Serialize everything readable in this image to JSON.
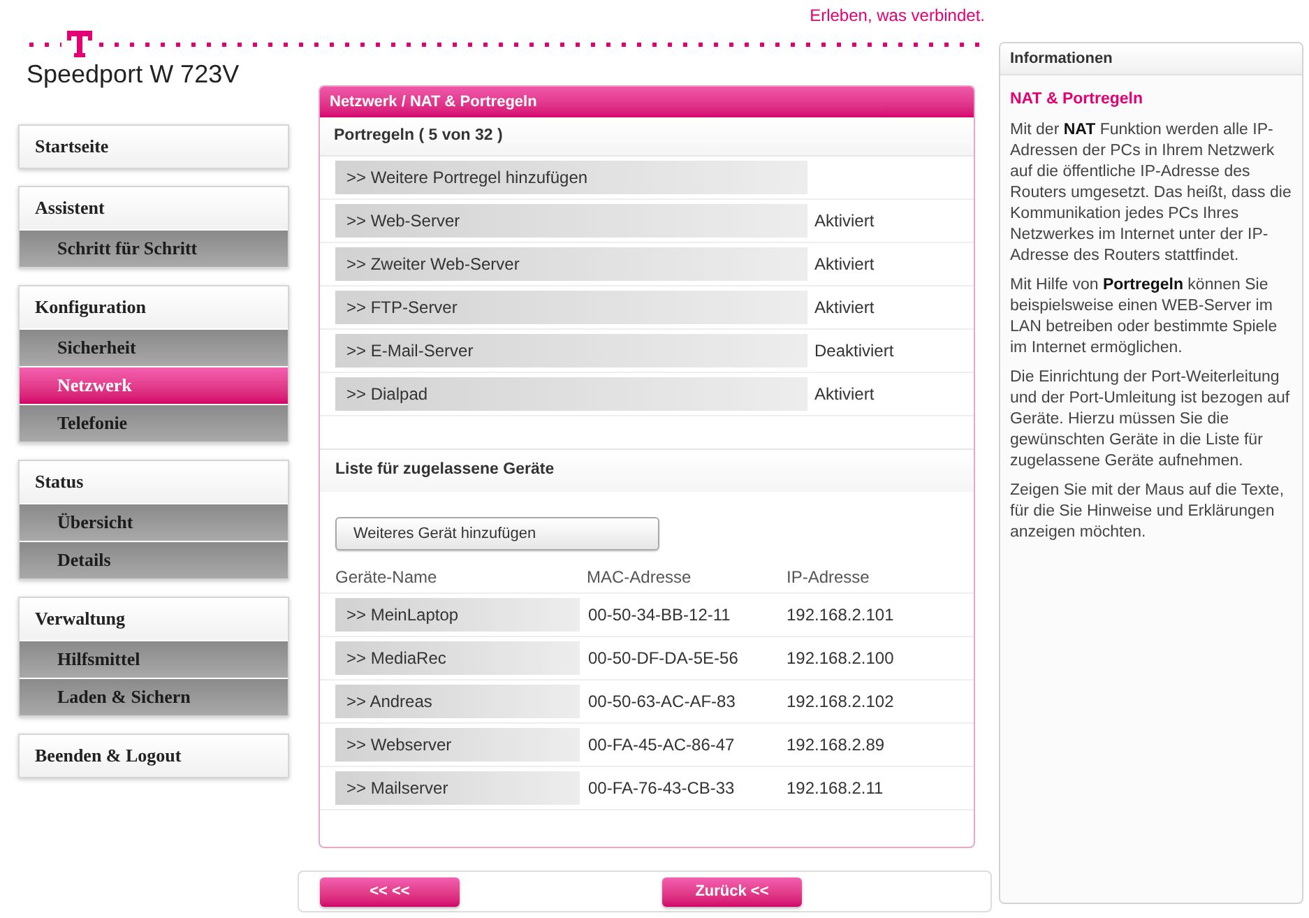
{
  "header": {
    "tagline": "Erleben, was verbindet."
  },
  "sidebar": {
    "title": "Speedport W 723V",
    "groups": [
      {
        "label": "Startseite",
        "selected": false
      },
      {
        "label": "Assistent",
        "selected": false,
        "items": [
          {
            "label": "Schritt für Schritt",
            "selected": false
          }
        ]
      },
      {
        "label": "Konfiguration",
        "selected": false,
        "items": [
          {
            "label": "Sicherheit",
            "selected": false
          },
          {
            "label": "Netzwerk",
            "selected": true
          },
          {
            "label": "Telefonie",
            "selected": false
          }
        ]
      },
      {
        "label": "Status",
        "selected": false,
        "items": [
          {
            "label": "Übersicht",
            "selected": false
          },
          {
            "label": "Details",
            "selected": false
          }
        ]
      },
      {
        "label": "Verwaltung",
        "selected": false,
        "items": [
          {
            "label": "Hilfsmittel",
            "selected": false
          },
          {
            "label": "Laden & Sichern",
            "selected": false
          }
        ]
      },
      {
        "label": "Beenden & Logout",
        "selected": false
      }
    ]
  },
  "panel": {
    "title": "Netzwerk / NAT & Portregeln",
    "port_rules": {
      "heading": "Portregeln ( 5 von 32 )",
      "add_link": ">> Weitere Portregel hinzufügen",
      "rules": [
        {
          "name": ">> Web-Server",
          "status": "Aktiviert"
        },
        {
          "name": ">> Zweiter Web-Server",
          "status": "Aktiviert"
        },
        {
          "name": ">> FTP-Server",
          "status": "Aktiviert"
        },
        {
          "name": ">> E-Mail-Server",
          "status": "Deaktiviert"
        },
        {
          "name": ">> Dialpad",
          "status": "Aktiviert"
        }
      ]
    },
    "devices": {
      "heading": "Liste für zugelassene Geräte",
      "add_button": "Weiteres Gerät hinzufügen",
      "columns": [
        "Geräte-Name",
        "MAC-Adresse",
        "IP-Adresse"
      ],
      "rows": [
        {
          "name": ">> MeinLaptop",
          "mac": "00-50-34-BB-12-11",
          "ip": "192.168.2.101"
        },
        {
          "name": ">> MediaRec",
          "mac": "00-50-DF-DA-5E-56",
          "ip": "192.168.2.100"
        },
        {
          "name": ">> Andreas",
          "mac": "00-50-63-AC-AF-83",
          "ip": "192.168.2.102"
        },
        {
          "name": ">> Webserver",
          "mac": "00-FA-45-AC-86-47",
          "ip": "192.168.2.89"
        },
        {
          "name": ">> Mailserver",
          "mac": "00-FA-76-43-CB-33",
          "ip": "192.168.2.11"
        }
      ]
    }
  },
  "footer_buttons": [
    "<< <<",
    "Zurück <<"
  ],
  "info": {
    "title": "Informationen",
    "heading": "NAT & Portregeln",
    "paragraphs": [
      "Mit der **NAT** Funktion werden alle IP-Adressen der PCs in Ihrem Netzwerk auf die öffentliche IP-Adresse des Routers umgesetzt. Das heißt, dass die Kommunikation jedes PCs Ihres Netzwerkes im Internet unter der IP-Adresse des Routers stattfindet.",
      "Mit Hilfe von **Portregeln** können Sie beispielsweise einen WEB-Server im LAN betreiben oder bestimmte Spiele im Internet ermöglichen.",
      "Die Einrichtung der Port-Weiterleitung und der Port-Umleitung ist bezogen auf Geräte. Hierzu müssen Sie die gewünschten Geräte in die Liste für zugelassene Geräte aufnehmen.",
      "Zeigen Sie mit der Maus auf die Texte, für die Sie Hinweise und Erklärungen anzeigen möchten."
    ]
  }
}
